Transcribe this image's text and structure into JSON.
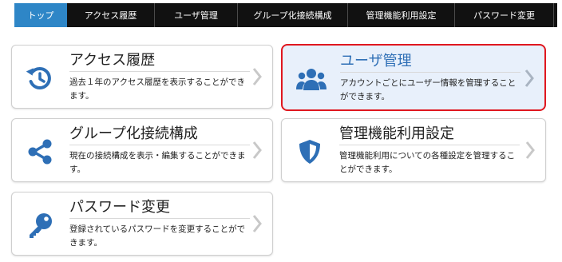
{
  "nav": {
    "tabs": [
      {
        "label": "トップ",
        "active": true
      },
      {
        "label": "アクセス履歴"
      },
      {
        "label": "ユーザ管理"
      },
      {
        "label": "グループ化接続構成"
      },
      {
        "label": "管理機能利用設定"
      },
      {
        "label": "パスワード変更"
      }
    ]
  },
  "cards": [
    {
      "title": "アクセス履歴",
      "desc": "過去１年のアクセス履歴を表示することができます。",
      "icon": "history-icon"
    },
    {
      "title": "ユーザ管理",
      "desc": "アカウントごとにユーザー情報を管理することができます。",
      "icon": "users-icon",
      "highlighted": true
    },
    {
      "title": "グループ化接続構成",
      "desc": "現在の接続構成を表示・編集することができます。",
      "icon": "share-icon"
    },
    {
      "title": "管理機能利用設定",
      "desc": "管理機能利用についての各種設定を管理することができます。",
      "icon": "shield-icon"
    },
    {
      "title": "パスワード変更",
      "desc": "登録されているパスワードを変更することができます。",
      "icon": "key-icon"
    }
  ],
  "colors": {
    "accent": "#2e86c7",
    "icon": "#2e6fb6",
    "highlight_border": "#e0171f",
    "highlight_bg": "#e8f0fb",
    "chevron": "#c8c8c8"
  }
}
